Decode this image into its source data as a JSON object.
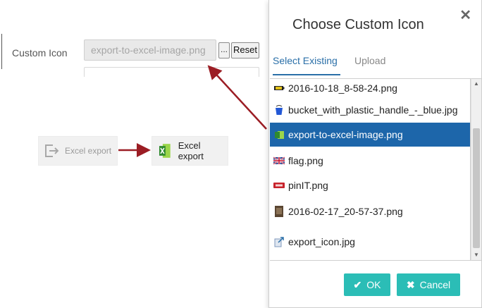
{
  "form": {
    "label": "Custom Icon",
    "input_value": "export-to-excel-image.png",
    "dots_label": "...",
    "reset_label": "Reset"
  },
  "excel": {
    "before_label": "Excel export",
    "after_label": "Excel export"
  },
  "modal": {
    "title": "Choose Custom Icon",
    "close_glyph": "✕",
    "tabs": [
      {
        "label": "Select Existing",
        "active": true
      },
      {
        "label": "Upload",
        "active": false
      }
    ],
    "files": [
      {
        "name": "2016-10-18_8-58-24.png",
        "icon": "battery-thumb-icon",
        "selected": false
      },
      {
        "name": "bucket_with_plastic_handle_-_blue.jpg",
        "icon": "blue-bucket-thumb-icon",
        "selected": false
      },
      {
        "name": "export-to-excel-image.png",
        "icon": "excel-thumb-icon",
        "selected": true
      },
      {
        "name": "flag.png",
        "icon": "uk-flag-thumb-icon",
        "selected": false
      },
      {
        "name": "pinIT.png",
        "icon": "pinit-thumb-icon",
        "selected": false
      },
      {
        "name": "2016-02-17_20-57-37.png",
        "icon": "photo-thumb-icon",
        "selected": false
      },
      {
        "name": "export_icon.jpg",
        "icon": "export-thumb-icon",
        "selected": false
      }
    ],
    "ok_label": "OK",
    "cancel_label": "Cancel"
  },
  "colors": {
    "accent": "#2bbdb6",
    "selection": "#1d66aa",
    "tab_active": "#2a6fa8",
    "arrow": "#9b1d24"
  }
}
